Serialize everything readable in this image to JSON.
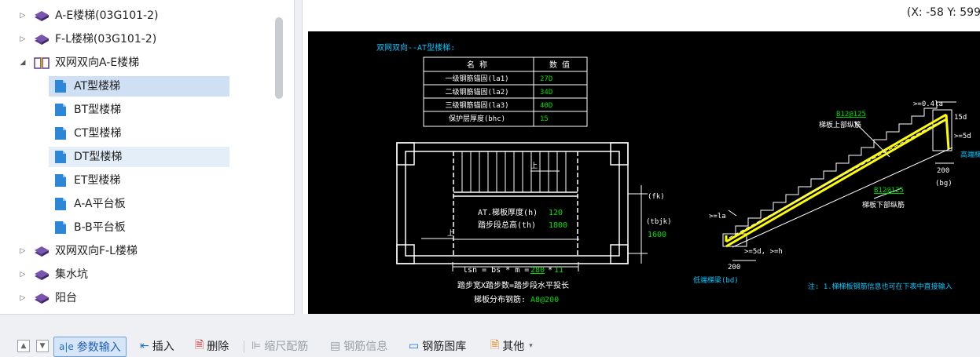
{
  "tree": {
    "items": [
      {
        "label": "A-E楼梯(03G101-2)",
        "expander": "▷",
        "icon": "book-stack-icon"
      },
      {
        "label": "F-L楼梯(03G101-2)",
        "expander": "▷",
        "icon": "book-stack-icon"
      },
      {
        "label": "双网双向A-E楼梯",
        "expander": "◢",
        "icon": "open-book-icon"
      },
      {
        "label": "AT型楼梯",
        "expander": "",
        "icon": "page-icon",
        "state": "selected"
      },
      {
        "label": "BT型楼梯",
        "expander": "",
        "icon": "page-icon"
      },
      {
        "label": "CT型楼梯",
        "expander": "",
        "icon": "page-icon"
      },
      {
        "label": "DT型楼梯",
        "expander": "",
        "icon": "page-icon",
        "state": "hover"
      },
      {
        "label": "ET型楼梯",
        "expander": "",
        "icon": "page-icon"
      },
      {
        "label": "A-A平台板",
        "expander": "",
        "icon": "page-icon"
      },
      {
        "label": "B-B平台板",
        "expander": "",
        "icon": "page-icon"
      },
      {
        "label": "双网双向F-L楼梯",
        "expander": "▷",
        "icon": "book-stack-icon"
      },
      {
        "label": "集水坑",
        "expander": "▷",
        "icon": "book-stack-icon"
      },
      {
        "label": "阳台",
        "expander": "▷",
        "icon": "book-stack-icon"
      }
    ]
  },
  "coords": "(X: -58 Y: 599",
  "drawing": {
    "title": "双网双向--AT型楼梯:",
    "table": {
      "headers": [
        "名  称",
        "数  值"
      ],
      "rows": [
        [
          "一级钢筋锚固(la1)",
          "27D"
        ],
        [
          "二级钢筋锚固(la2)",
          "34D"
        ],
        [
          "三级钢筋锚固(la3)",
          "40D"
        ],
        [
          "保护层厚度(bhc)",
          "15"
        ]
      ]
    },
    "plan": {
      "thickness_label": "AT.梯板厚度(h)",
      "thickness_value": "120",
      "height_label": "踏步段总高(th)",
      "height_value": "1800",
      "up_label": "上",
      "fk_label": "(fk)",
      "tbjk_label": "(tbjk)",
      "tbjk_value": "1600",
      "formula_prefix": "lsn = bs * m =",
      "formula_value": "280",
      "formula_star": "*",
      "formula_m": "11",
      "formula_caption": "踏步宽X踏步数=踏步段水平投长",
      "dist_label": "梯板分布钢筋:",
      "dist_value": "A8@200"
    },
    "section": {
      "top_bar": "B12@125",
      "top_bar_label": "梯板上部纵筋",
      "bottom_bar": "B12@125",
      "bottom_bar_label": "梯板下部纵筋",
      "top_anchor": ">=0.4la",
      "top_15d": "15d",
      "top_5d": ">=5d",
      "high_beam": "高端梯",
      "dim_200_top": "200",
      "bg_label": "(bg)",
      "la_label": ">=la",
      "low_5d": ">=5d, >=h",
      "dim_200_low": "200",
      "low_beam": "低端梯梁(bd)",
      "note": "注: 1.梯梯板钢筋信息也可在下表中直接输入"
    },
    "colors": {
      "white": "#ffffff",
      "green": "#00e000",
      "cyan": "#00c8ff",
      "yellow": "#ffff00"
    }
  },
  "toolbar": {
    "up": "上移",
    "down": "下移",
    "param_input": "参数输入",
    "insert": "插入",
    "delete": "删除",
    "scale": "缩尺配筋",
    "info": "钢筋信息",
    "library": "钢筋图库",
    "other": "其他"
  }
}
